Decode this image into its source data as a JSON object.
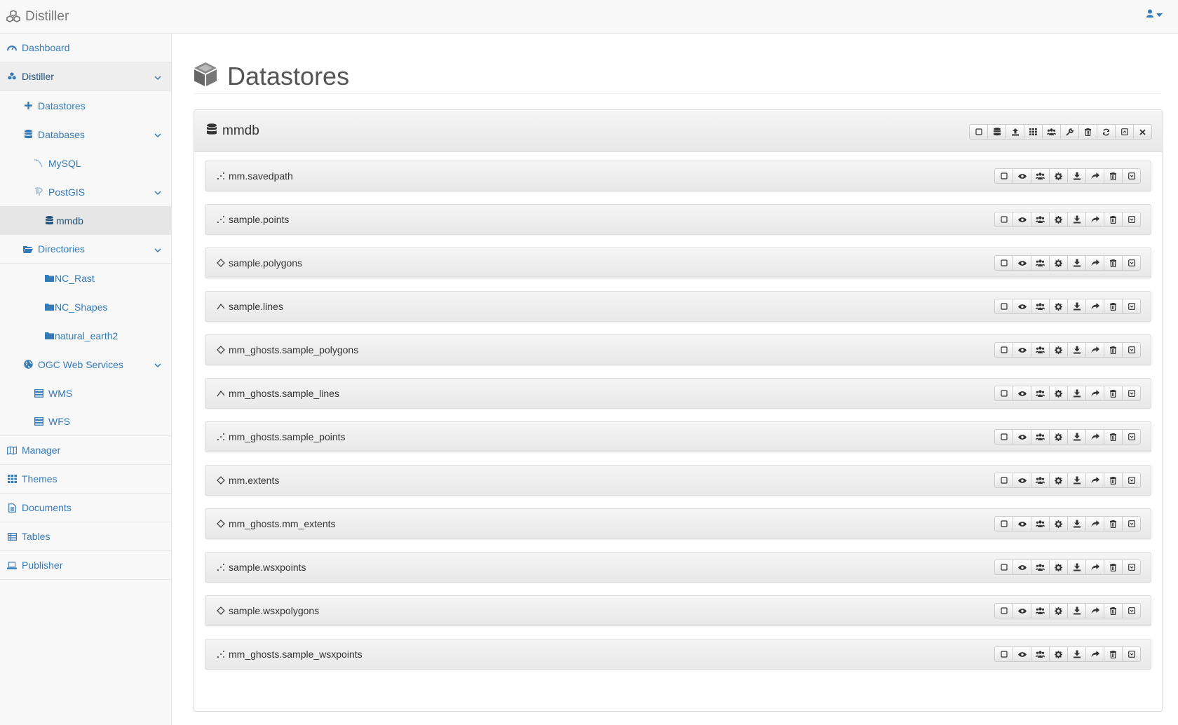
{
  "app": {
    "title": "Distiller"
  },
  "sidebar": {
    "dashboard": "Dashboard",
    "distiller": "Distiller",
    "datastores": "Datastores",
    "databases": "Databases",
    "mysql": "MySQL",
    "postgis": "PostGIS",
    "mmdb": "mmdb",
    "directories": "Directories",
    "nc_rast": "NC_Rast",
    "nc_shapes": "NC_Shapes",
    "natural_earth2": "natural_earth2",
    "ogc": "OGC Web Services",
    "wms": "WMS",
    "wfs": "WFS",
    "manager": "Manager",
    "themes": "Themes",
    "documents": "Documents",
    "tables": "Tables",
    "publisher": "Publisher"
  },
  "page": {
    "title": "Datastores"
  },
  "datastore": {
    "name": "mmdb",
    "toolbar_icons": [
      "checkbox-icon",
      "database-icon",
      "upload-icon",
      "grid-icon",
      "users-icon",
      "wrench-icon",
      "trash-icon",
      "refresh-icon",
      "collapse-icon",
      "close-icon"
    ]
  },
  "layers": [
    {
      "name": "mm.savedpath",
      "geom": "point"
    },
    {
      "name": "sample.points",
      "geom": "point"
    },
    {
      "name": "sample.polygons",
      "geom": "polygon"
    },
    {
      "name": "sample.lines",
      "geom": "line"
    },
    {
      "name": "mm_ghosts.sample_polygons",
      "geom": "polygon"
    },
    {
      "name": "mm_ghosts.sample_lines",
      "geom": "line"
    },
    {
      "name": "mm_ghosts.sample_points",
      "geom": "point"
    },
    {
      "name": "mm.extents",
      "geom": "polygon"
    },
    {
      "name": "mm_ghosts.mm_extents",
      "geom": "polygon"
    },
    {
      "name": "sample.wsxpoints",
      "geom": "point"
    },
    {
      "name": "sample.wsxpolygons",
      "geom": "polygon"
    },
    {
      "name": "mm_ghosts.sample_wsxpoints",
      "geom": "point"
    }
  ],
  "layer_toolbar_icons": [
    "checkbox-icon",
    "eye-icon",
    "users-icon",
    "gear-icon",
    "download-icon",
    "share-icon",
    "trash-icon",
    "collapse-icon"
  ],
  "colors": {
    "link": "#337ab7",
    "active_link": "#23527c",
    "navbar_bg": "#f8f8f8"
  }
}
